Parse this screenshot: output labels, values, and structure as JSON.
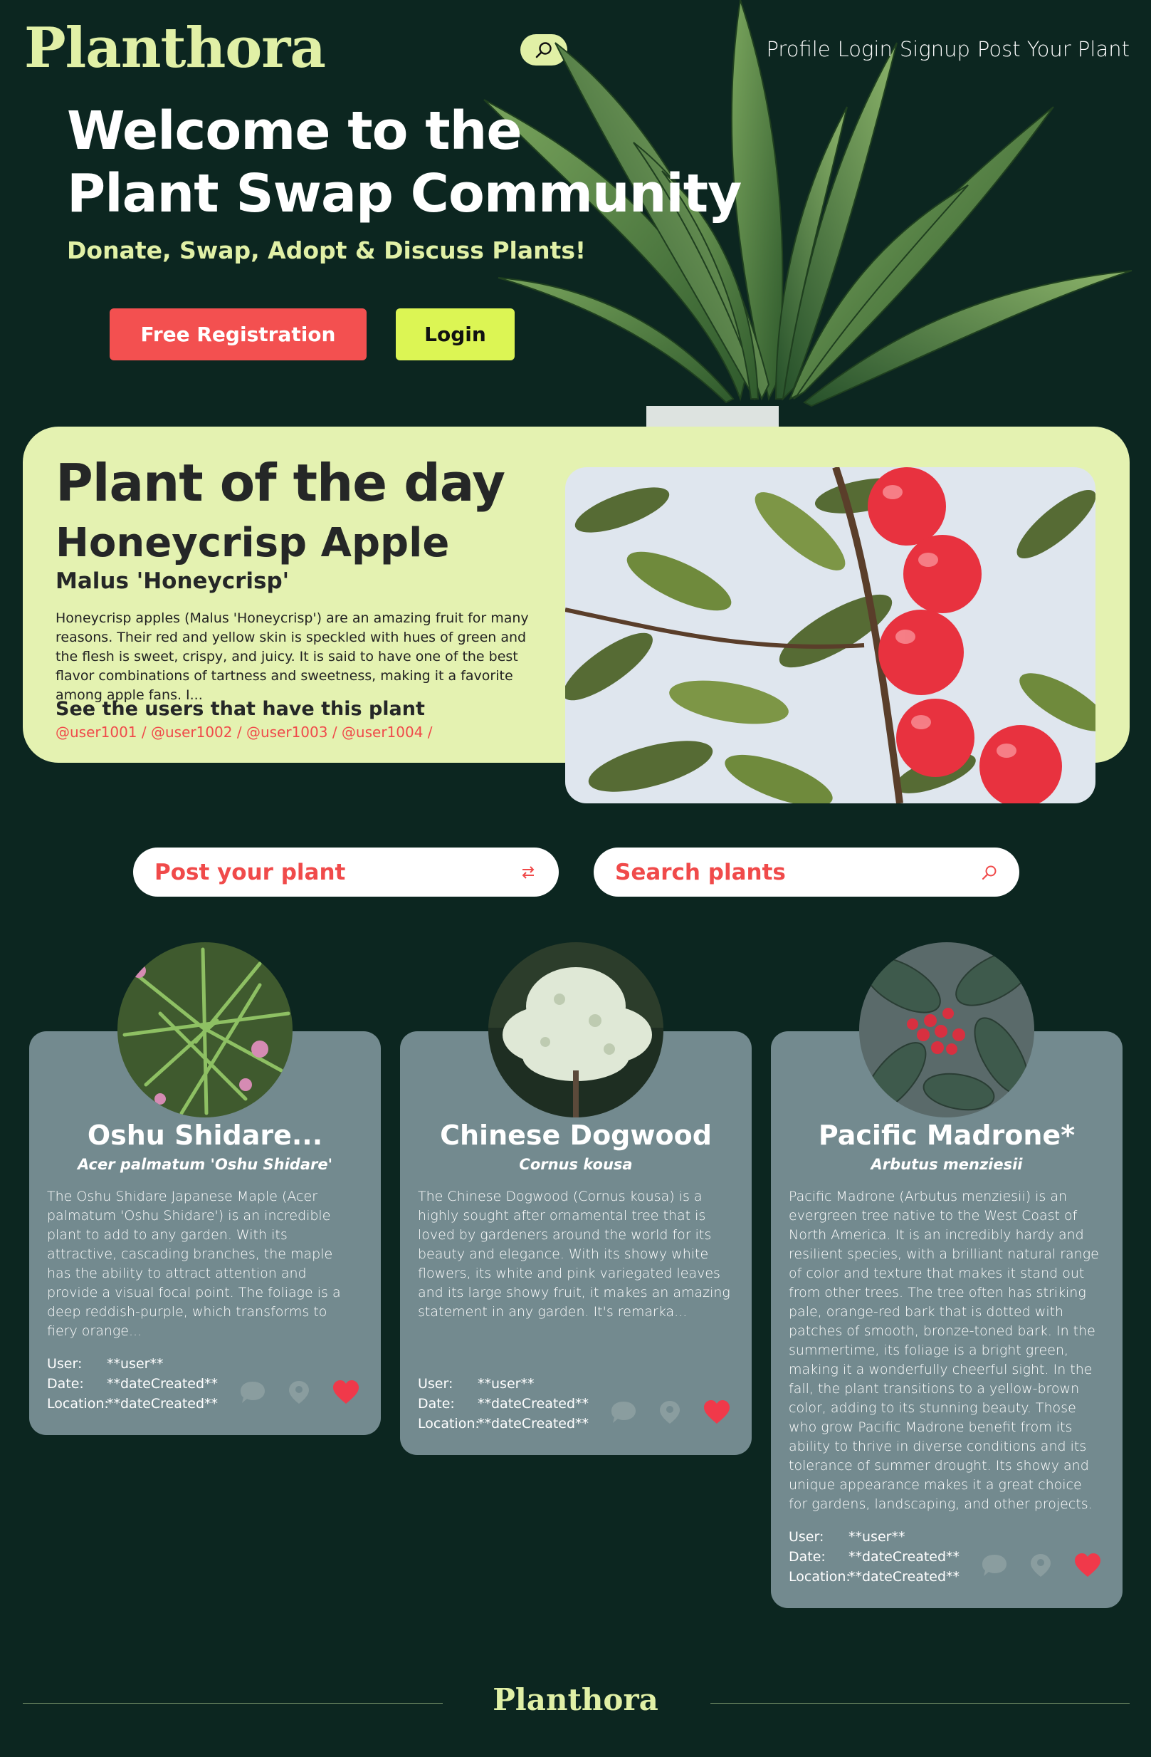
{
  "brand": {
    "name": "Planthora"
  },
  "nav": {
    "items": [
      "Profile",
      "Login",
      "Signup",
      "Post Your Plant"
    ]
  },
  "hero": {
    "title_line1": "Welcome to the",
    "title_line2": "Plant Swap Community",
    "subtitle": "Donate, Swap, Adopt & Discuss Plants!",
    "register_label": "Free Registration",
    "login_label": "Login"
  },
  "plant_of_day": {
    "heading": "Plant of the day",
    "name": "Honeycrisp Apple",
    "scientific": "Malus 'Honeycrisp'",
    "description": "Honeycrisp apples (Malus 'Honeycrisp') are an amazing fruit for many reasons. Their red and yellow skin is speckled with hues of green and the flesh is sweet, crispy, and juicy. It is said to have one of the best flavor combinations of tartness and sweetness, making it a favorite among apple fans. I...",
    "users_heading": "See the users that have this plant",
    "users": "@user1001 / @user1002 / @user1003 / @user1004 /"
  },
  "actions": {
    "post_label": "Post your plant",
    "search_label": "Search plants"
  },
  "cards": [
    {
      "title": "Oshu Shidare...",
      "scientific": "Acer palmatum 'Oshu Shidare'",
      "description": "The Oshu Shidare Japanese Maple (Acer palmatum 'Oshu Shidare') is an incredible plant to add to any garden. With its attractive, cascading branches, the maple has the ability to attract attention and provide a visual focal point. The foliage is a deep reddish-purple, which transforms to fiery orange...",
      "user_label": "User:",
      "user": "**user**",
      "date_label": "Date:",
      "date": "**dateCreated**",
      "location_label": "Location:",
      "location": "**dateCreated**"
    },
    {
      "title": "Chinese Dogwood",
      "scientific": "Cornus kousa",
      "description": "The Chinese Dogwood (Cornus kousa) is a highly sought after ornamental tree that is loved by gardeners around the world for its beauty and elegance. With its showy white flowers, its white and pink variegated leaves and its large showy fruit, it makes an amazing statement in any garden. It's remarka...",
      "user_label": "User:",
      "user": "**user**",
      "date_label": "Date:",
      "date": "**dateCreated**",
      "location_label": "Location:",
      "location": "**dateCreated**"
    },
    {
      "title": "Pacific Madrone*",
      "scientific": "Arbutus menziesii",
      "description": "Pacific Madrone (Arbutus menziesii) is an evergreen tree native to the West Coast of North America. It is an incredibly hardy and resilient species, with a brilliant natural range of color and texture that makes it stand out from other trees. The tree often has striking pale, orange-red bark that is dotted with patches of smooth, bronze-toned bark. In the summertime, its foliage is a bright green, making it a wonderfully cheerful sight. In the fall, the plant transitions to a yellow-brown color, adding to its stunning beauty. Those who grow Pacific Madrone benefit from its ability to thrive in diverse conditions and its tolerance of summer drought. Its showy and unique appearance makes it a great choice for gardens, landscaping, and other projects.",
      "user_label": "User:",
      "user": "**user**",
      "date_label": "Date:",
      "date": "**dateCreated**",
      "location_label": "Location:",
      "location": "**dateCreated**"
    }
  ],
  "footer": {
    "brand": "Planthora"
  },
  "colors": {
    "background": "#0c2620",
    "accent_lime": "#e1f0a6",
    "accent_red": "#f35050",
    "card": "#738a8f"
  }
}
